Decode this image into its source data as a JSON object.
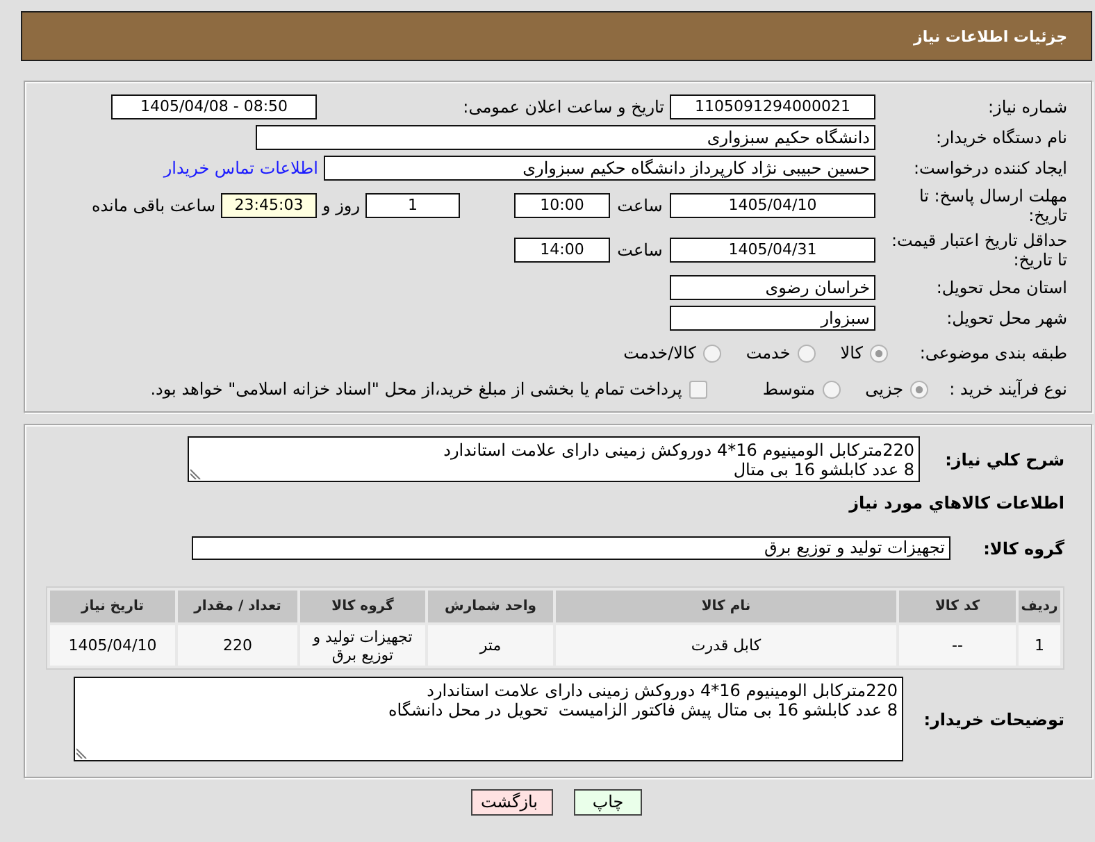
{
  "header": {
    "title": "جزئیات اطلاعات نیاز"
  },
  "details": {
    "need_number": {
      "label": "شماره نیاز:",
      "value": "1105091294000021"
    },
    "announcement": {
      "label": "تاریخ و ساعت اعلان عمومی:",
      "value": "1405/04/08 - 08:50"
    },
    "buyer_org": {
      "label": "نام دستگاه خریدار:",
      "value": "دانشگاه حکیم سبزواری"
    },
    "requester": {
      "label": "ایجاد کننده درخواست:",
      "value": "حسین حبیبی نژاد کارپرداز دانشگاه حکیم سبزواری",
      "contact_link": "اطلاعات تماس خریدار"
    },
    "reply_deadline": {
      "label": "مهلت ارسال پاسخ: تا تاریخ:",
      "date": "1405/04/10",
      "time_label": "ساعت",
      "time": "10:00",
      "days": "1",
      "days_label": "روز و",
      "remaining": "23:45:03",
      "remaining_label": "ساعت باقی مانده"
    },
    "price_validity": {
      "label": "حداقل تاریخ اعتبار قیمت: تا تاریخ:",
      "date": "1405/04/31",
      "time_label": "ساعت",
      "time": "14:00"
    },
    "province": {
      "label": "استان محل تحویل:",
      "value": "خراسان رضوی"
    },
    "city": {
      "label": "شهر محل تحویل:",
      "value": "سبزوار"
    },
    "category": {
      "label": "طبقه بندی موضوعی:",
      "options": [
        {
          "label": "کالا",
          "selected": true
        },
        {
          "label": "خدمت",
          "selected": false
        },
        {
          "label": "کالا/خدمت",
          "selected": false
        }
      ]
    },
    "purchase_type": {
      "label": "نوع فرآیند خرید :",
      "options": [
        {
          "label": "جزیی",
          "selected": true
        },
        {
          "label": "متوسط",
          "selected": false
        }
      ],
      "treasury": {
        "label": "پرداخت تمام یا بخشی از مبلغ خرید،از محل \"اسناد خزانه اسلامی\" خواهد بود.",
        "checked": false
      }
    }
  },
  "needs": {
    "description_label": "شرح کلي نیاز:",
    "description": "220مترکابل الومینیوم 16*4 دوروکش زمینی دارای علامت استاندارد\n8 عدد کابلشو 16 بی متال",
    "goods_title": "اطلاعات کالاهاي مورد نیاز",
    "group_label": "گروه کالا:",
    "group": "تجهیزات تولید و توزیع برق",
    "table": {
      "columns": [
        "ردیف",
        "کد کالا",
        "نام کالا",
        "واحد شمارش",
        "گروه کالا",
        "تعداد / مقدار",
        "تاریخ نیاز"
      ],
      "rows": [
        [
          "1",
          "--",
          "کابل قدرت",
          "متر",
          "تجهیزات تولید و توزیع برق",
          "220",
          "1405/04/10"
        ]
      ]
    },
    "notes_label": "توضیحات خریدار:",
    "notes": "220مترکابل الومینیوم 16*4 دوروکش زمینی دارای علامت استاندارد\n8 عدد کابلشو 16 بی متال پیش فاکتور الزامیست  تحویل در محل دانشگاه"
  },
  "buttons": [
    {
      "kind": "print",
      "label": "چاپ"
    },
    {
      "kind": "back",
      "label": "بازگشت"
    }
  ]
}
